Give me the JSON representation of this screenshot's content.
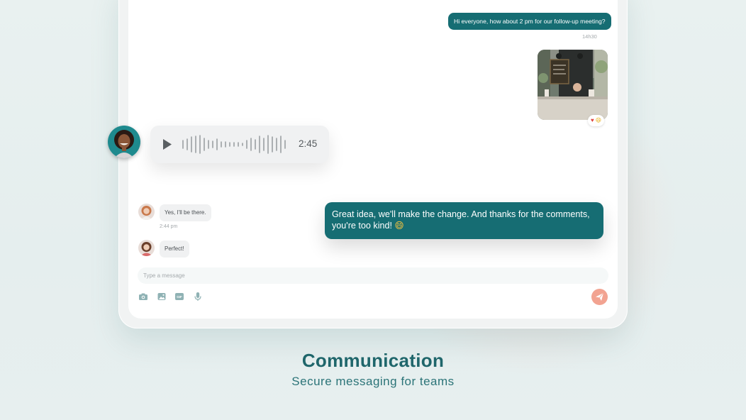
{
  "chat": {
    "outgoing_message_1": "Hi everyone, how about 2 pm for our follow-up meeting?",
    "outgoing_time_1": "14h30",
    "photo_reactions": "♥",
    "photo_reactions_2": "😄",
    "voice_message": {
      "duration": "2:45",
      "play_icon": "play-icon"
    },
    "incoming_message_1": "Yes, I'll be there.",
    "incoming_time_1": "2:44 pm",
    "incoming_message_2": "Perfect!",
    "outgoing_message_2": "Great idea, we'll make the change. And thanks for the comments, you're too kind!",
    "outgoing_message_2_emoji": "😄"
  },
  "composer": {
    "placeholder": "Type a message",
    "tools": [
      "camera-icon",
      "image-icon",
      "gif-icon",
      "microphone-icon"
    ],
    "gif_label": "GIF",
    "send_icon": "send-icon"
  },
  "caption": {
    "title": "Communication",
    "subtitle": "Secure messaging for teams"
  },
  "colors": {
    "accent": "#166d73",
    "send_button": "#f2a391",
    "background": "#e9f1f0"
  }
}
